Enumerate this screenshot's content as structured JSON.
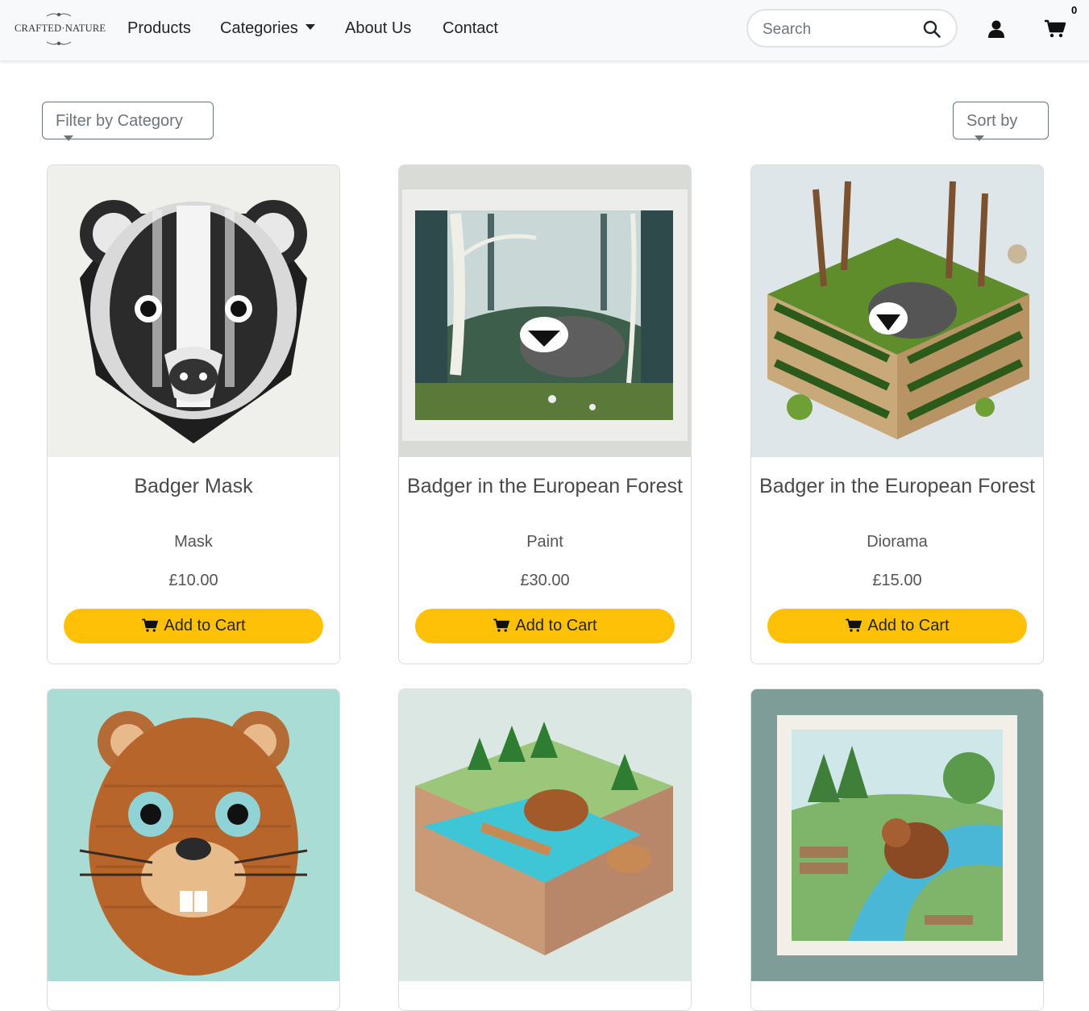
{
  "brand": {
    "logo_text": "CRAFTED·NATURE"
  },
  "nav": {
    "products": "Products",
    "categories": "Categories",
    "about": "About Us",
    "contact": "Contact"
  },
  "search": {
    "placeholder": "Search"
  },
  "cart": {
    "count": "0"
  },
  "filters": {
    "category": "Filter by Category",
    "sort": "Sort by"
  },
  "cart_button_label": "Add to Cart",
  "products": [
    {
      "title": "Badger Mask",
      "category": "Mask",
      "price": "£10.00"
    },
    {
      "title": "Badger in the European Forest",
      "category": "Paint",
      "price": "£30.00"
    },
    {
      "title": "Badger in the European Forest",
      "category": "Diorama",
      "price": "£15.00"
    }
  ],
  "colors": {
    "accent": "#ffc107",
    "navbar_bg": "#f8f9fa"
  }
}
